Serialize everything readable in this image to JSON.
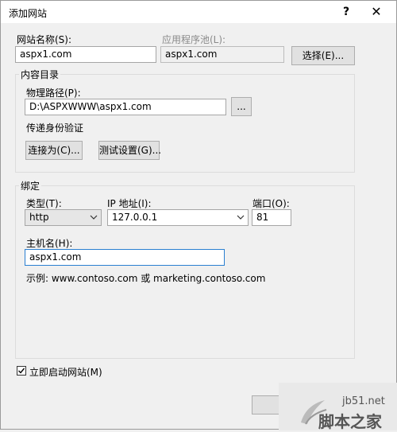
{
  "dialog": {
    "title": "添加网站",
    "help": "?",
    "close": "✕"
  },
  "site": {
    "name_label": "网站名称(S):",
    "name_value": "aspx1.com",
    "pool_label": "应用程序池(L):",
    "pool_value": "aspx1.com",
    "select_button": "选择(E)..."
  },
  "content_dir": {
    "group_title": "内容目录",
    "path_label": "物理路径(P):",
    "path_value": "D:\\ASPXWWW\\aspx1.com",
    "browse_button": "...",
    "auth_label": "传递身份验证",
    "connect_button": "连接为(C)...",
    "test_button": "测试设置(G)..."
  },
  "binding": {
    "group_title": "绑定",
    "type_label": "类型(T):",
    "type_value": "http",
    "ip_label": "IP 地址(I):",
    "ip_value": "127.0.0.1",
    "port_label": "端口(O):",
    "port_value": "81",
    "host_label": "主机名(H):",
    "host_value": "aspx1.com",
    "example": "示例: www.contoso.com 或 marketing.contoso.com"
  },
  "start_site": {
    "label": "立即启动网站(M)",
    "checked": true
  },
  "watermark": {
    "site": "jb51.net",
    "brand": "脚本之家"
  },
  "colors": {
    "focus_border": "#2a7fd1",
    "disabled_text": "#8a8a8a"
  }
}
